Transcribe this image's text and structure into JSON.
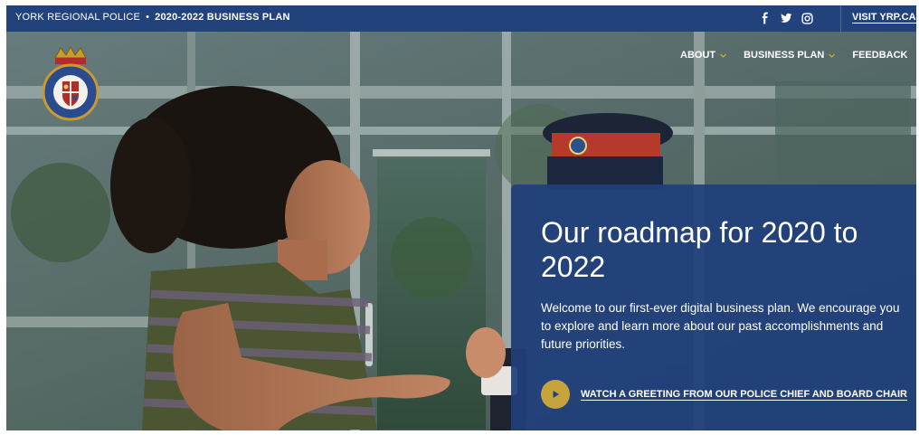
{
  "topbar": {
    "site_name": "YORK REGIONAL POLICE",
    "separator": "•",
    "plan_title": "2020-2022 BUSINESS PLAN",
    "social": [
      {
        "icon": "facebook-icon",
        "glyph": "f"
      },
      {
        "icon": "twitter-icon",
        "glyph": "bird"
      },
      {
        "icon": "instagram-icon",
        "glyph": "camera"
      }
    ],
    "visit_label": "VISIT YRP.CA"
  },
  "logo": {
    "icon": "york-regional-police-crest-icon",
    "text": "YORK REGIONAL POLICE"
  },
  "nav": {
    "items": [
      {
        "label": "ABOUT",
        "has_dropdown": true
      },
      {
        "label": "BUSINESS PLAN",
        "has_dropdown": true
      },
      {
        "label": "FEEDBACK",
        "has_dropdown": false
      }
    ]
  },
  "hero": {
    "heading": "Our roadmap for 2020 to 2022",
    "body": "Welcome to our first-ever digital business plan. We encourage you to explore and learn more about our past accomplishments and future priorities.",
    "cta_icon": "play-icon",
    "cta_label": "WATCH A GREETING FROM OUR POLICE CHIEF AND BOARD CHAIR"
  },
  "colors": {
    "brand_blue": "#22427c",
    "card_blue": "#20407c",
    "accent_gold": "#c7a43b",
    "chevron": "#c7a43b"
  }
}
